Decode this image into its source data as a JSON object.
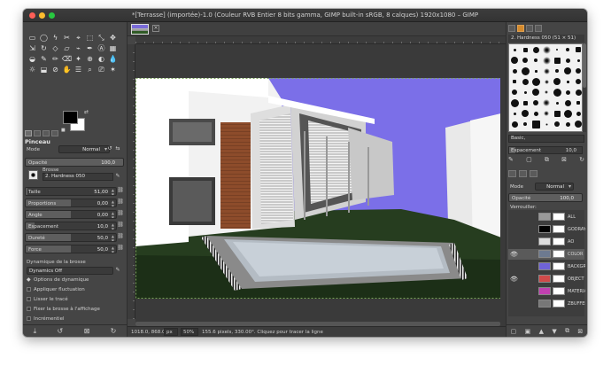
{
  "window": {
    "title": "*[Terrasse] (importée)-1.0 (Couleur RVB Entier 8 bits gamma, GIMP built-in sRGB, 8 calques) 1920x1080 – GIMP"
  },
  "toolbox": {
    "tools": [
      "▭",
      "◯",
      "ϟ",
      "✂",
      "⌖",
      "⬚",
      "⤡",
      "✥",
      "⇲",
      "↻",
      "◇",
      "▱",
      "⌁",
      "✒",
      "Ⓐ",
      "▦",
      "◒",
      "✎",
      "✏",
      "⌫",
      "✦",
      "⊕",
      "◐",
      "💧",
      "☼",
      "⬓",
      "⊘",
      "✋",
      "☰",
      "⌕",
      "⎚",
      "✶"
    ],
    "colors": {
      "fg": "#000000",
      "bg": "#ffffff"
    }
  },
  "tool_options": {
    "title": "Pinceau",
    "mode_label": "Mode",
    "mode_value": "Normal",
    "opacity_label": "Opacité",
    "opacity_value": "100,0",
    "brush_label": "Brosse",
    "brush_name": "2. Hardness 050",
    "sliders": [
      {
        "name": "Taille",
        "value": "51,00",
        "fill": 0.02
      },
      {
        "name": "Proportions",
        "value": "0,00",
        "fill": 0.5
      },
      {
        "name": "Angle",
        "value": "0,00",
        "fill": 0.5
      },
      {
        "name": "Espacement",
        "value": "10,0",
        "fill": 0.1
      },
      {
        "name": "Dureté",
        "value": "50,0",
        "fill": 0.5
      },
      {
        "name": "Force",
        "value": "50,0",
        "fill": 0.5
      }
    ],
    "dynamics_label": "Dynamique de la brosse",
    "dynamics_value": "Dynamics Off",
    "checks": [
      {
        "label": "Options de dynamique",
        "checked": true,
        "expander": true
      },
      {
        "label": "Appliquer fluctuation",
        "checked": false
      },
      {
        "label": "Lisser le tracé",
        "checked": false
      },
      {
        "label": "Fixer la brosse à l'affichage",
        "checked": false
      },
      {
        "label": "Incrémentiel",
        "checked": false
      }
    ]
  },
  "statusbar": {
    "coords": "1018.0, 868.0",
    "unit": "px",
    "zoom": "50%",
    "message": "155.6 pixels, 330.00°. Cliquez pour tracer la ligne"
  },
  "brushes": {
    "header": "2. Hardness 050 (51 × 51)",
    "tag": "Basic,",
    "spacing_label": "Espacement",
    "spacing_value": "10,0"
  },
  "layers": {
    "mode_label": "Mode",
    "mode_value": "Normal",
    "opacity_label": "Opacité",
    "opacity_value": "100,0",
    "lock_label": "Verrouiller:",
    "items": [
      {
        "name": "ALL",
        "visible": false,
        "thumb": "#999999"
      },
      {
        "name": "GODRAY",
        "visible": false,
        "thumb": "#000000"
      },
      {
        "name": "AO",
        "visible": false,
        "thumb": "#dddddd"
      },
      {
        "name": "COLOR",
        "visible": true,
        "thumb": "#6d7a90",
        "selected": true
      },
      {
        "name": "BACKGR",
        "visible": false,
        "thumb": "#6f63d8"
      },
      {
        "name": "OBJECT",
        "visible": true,
        "thumb": "#d04a4a"
      },
      {
        "name": "MATERIA",
        "visible": false,
        "thumb": "#c040b0"
      },
      {
        "name": "ZBUFFER",
        "visible": false,
        "thumb": "#777777"
      }
    ]
  }
}
